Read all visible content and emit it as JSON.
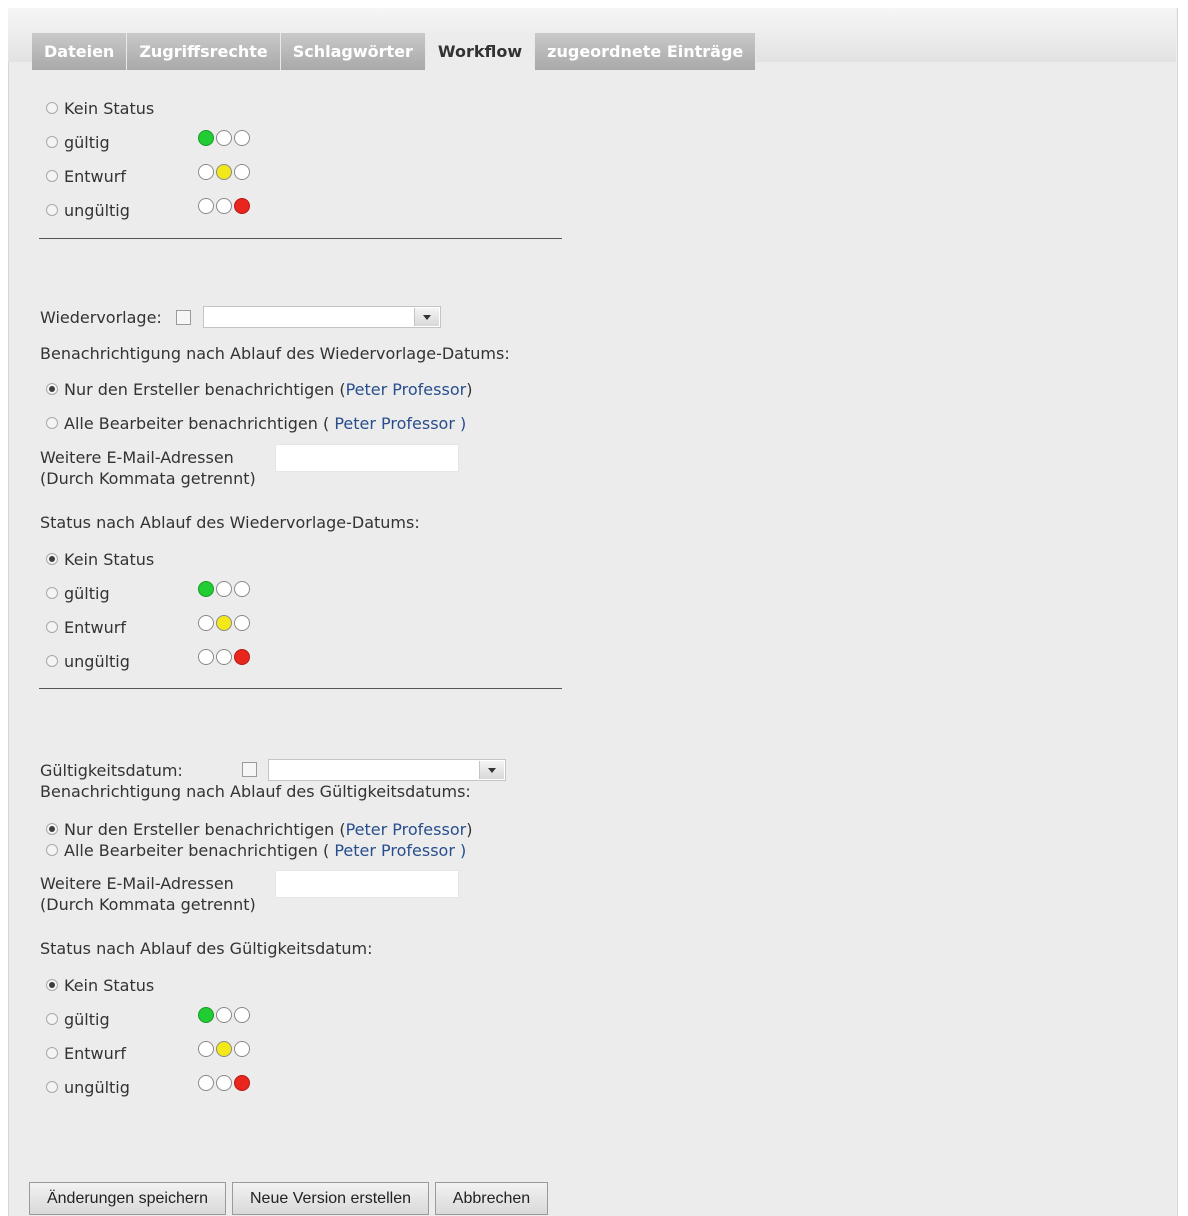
{
  "tabs": [
    {
      "label": "Dateien"
    },
    {
      "label": "Zugriffsrechte"
    },
    {
      "label": "Schlagwörter"
    },
    {
      "label": "Workflow"
    },
    {
      "label": "zugeordnete Einträge"
    }
  ],
  "status_options": [
    "Kein Status",
    "gültig",
    "Entwurf",
    "ungültig"
  ],
  "section1": {
    "selected": "none"
  },
  "wiedervorlage": {
    "label": "Wiedervorlage:",
    "notify_heading": "Benachrichtigung nach Ablauf des Wiedervorlage-Datums:",
    "notify_creator": "Nur den Ersteller benachrichtigen (",
    "notify_creator_name": "Peter Professor",
    "notify_creator_close": ")",
    "notify_all": "Alle Bearbeiter benachrichtigen ( ",
    "notify_all_name": "Peter Professor",
    "notify_all_close": " )",
    "emails_label_1": "Weitere E-Mail-Adressen",
    "emails_label_2": "(Durch Kommata getrennt)",
    "status_heading": "Status nach Ablauf des Wiedervorlage-Datums:"
  },
  "gueltigkeit": {
    "label": "Gültigkeitsdatum:",
    "notify_heading": "Benachrichtigung nach Ablauf des Gültigkeitsdatums:",
    "notify_creator": "Nur den Ersteller benachrichtigen (",
    "notify_creator_name": "Peter Professor",
    "notify_creator_close": ")",
    "notify_all": "Alle Bearbeiter benachrichtigen ( ",
    "notify_all_name": "Peter Professor",
    "notify_all_close": " )",
    "emails_label_1": "Weitere E-Mail-Adressen",
    "emails_label_2": "(Durch Kommata getrennt)",
    "status_heading": "Status nach Ablauf des Gültigkeitsdatum:"
  },
  "buttons": {
    "save": "Änderungen speichern",
    "new_version": "Neue Version erstellen",
    "cancel": "Abbrechen"
  },
  "colors": {
    "green": "#22cc33",
    "yellow": "#f2e81a",
    "red": "#e8261e",
    "link": "#274d8c"
  }
}
